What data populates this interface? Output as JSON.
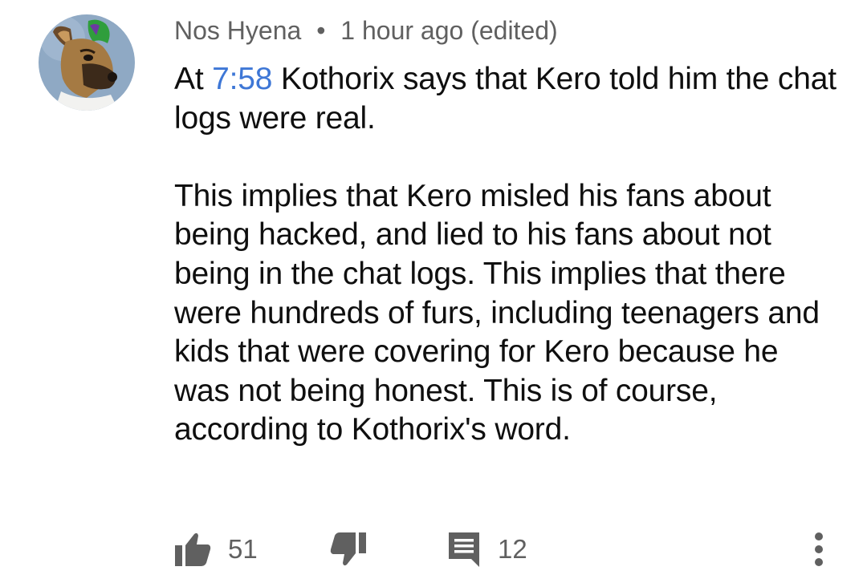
{
  "comment": {
    "author": "Nos Hyena",
    "separator": "•",
    "time": "1 hour ago (edited)",
    "text_prefix": "At ",
    "timestamp_link": "7:58",
    "text_line1_rest": " Kothorix says that Kero told him the chat logs were real.",
    "paragraph2": "This implies that Kero misled his fans about being hacked, and lied to his fans about not being in the chat logs. This implies that there were hundreds of furs, including teenagers and kids that were covering for Kero because he was not being honest. This is of course, according to Kothorix's word."
  },
  "actions": {
    "like_count": "51",
    "reply_count": "12"
  },
  "icons": {
    "like": "thumbs-up-icon",
    "dislike": "thumbs-down-icon",
    "reply": "comment-icon",
    "more": "more-vertical-icon"
  },
  "colors": {
    "link": "#3e77d6",
    "meta": "#606060",
    "text": "#0f0f0f"
  }
}
